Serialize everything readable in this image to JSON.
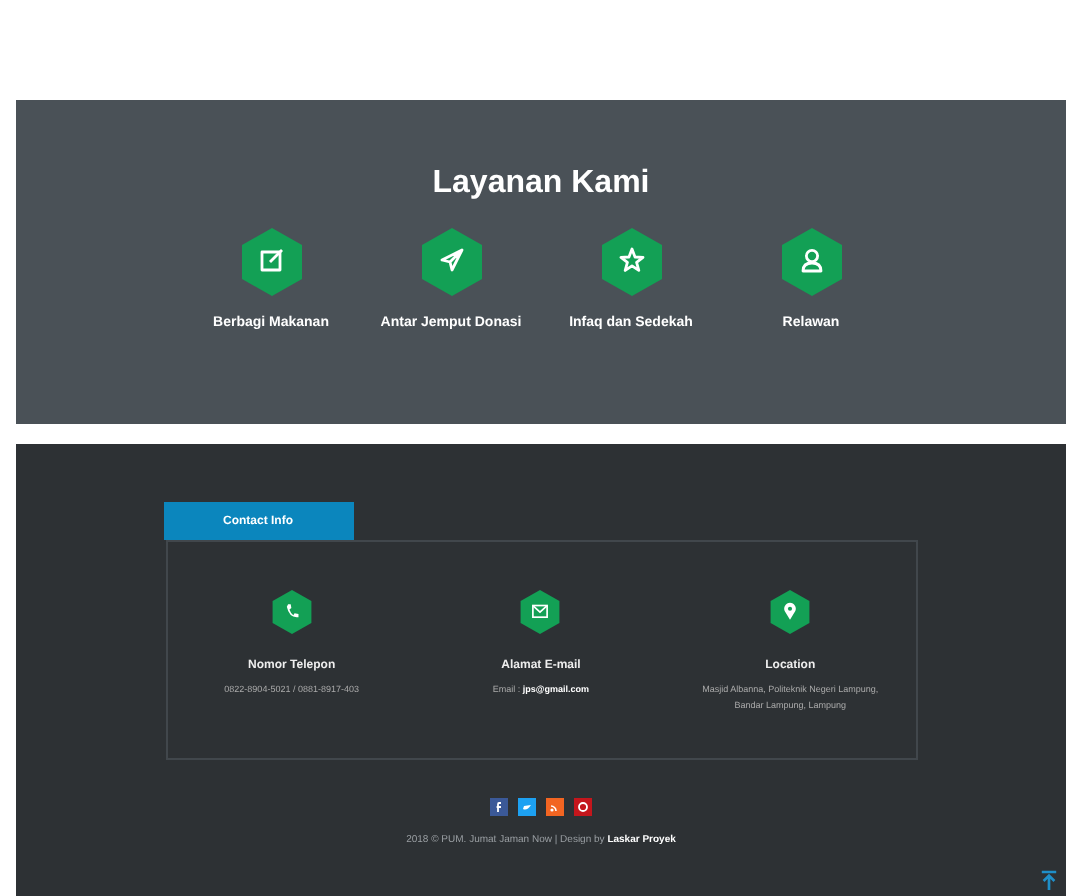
{
  "services": {
    "title": "Layanan Kami",
    "items": [
      {
        "label": "Berbagi Makanan"
      },
      {
        "label": "Antar Jemput Donasi"
      },
      {
        "label": "Infaq dan Sedekah"
      },
      {
        "label": "Relawan"
      }
    ]
  },
  "contact": {
    "tab": "Contact Info",
    "items": [
      {
        "title": "Nomor Telepon",
        "lines": [
          "0822-8904-5021 / 0881-8917-403"
        ]
      },
      {
        "title": "Alamat E-mail",
        "lines": [
          "Email : **jps@gmail.com**"
        ]
      },
      {
        "title": "Location",
        "lines": [
          "Masjid Albanna, Politeknik Negeri Lampung,",
          "Bandar Lampung, Lampung"
        ]
      }
    ]
  },
  "social": [
    {
      "color": "#3b5998"
    },
    {
      "color": "#1da1f2"
    },
    {
      "color": "#f26522"
    },
    {
      "color": "#c4161c"
    }
  ],
  "footer": "2018 © PUM. Jumat Jaman Now | Design by **Laskar Proyek**"
}
